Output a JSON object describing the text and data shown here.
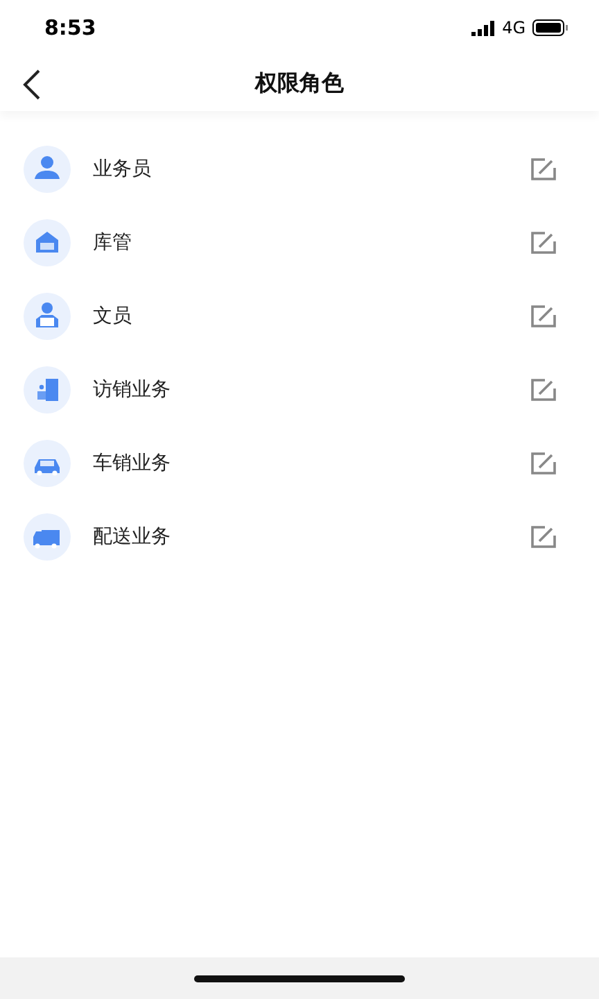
{
  "status_bar": {
    "time": "8:53",
    "network": "4G"
  },
  "nav": {
    "title": "权限角色"
  },
  "roles": [
    {
      "name": "业务员",
      "kind": "person"
    },
    {
      "name": "库管",
      "kind": "warehouse"
    },
    {
      "name": "文员",
      "kind": "clerk"
    },
    {
      "name": "访销业务",
      "kind": "visit"
    },
    {
      "name": "车销业务",
      "kind": "car"
    },
    {
      "name": "配送业务",
      "kind": "truck"
    }
  ]
}
